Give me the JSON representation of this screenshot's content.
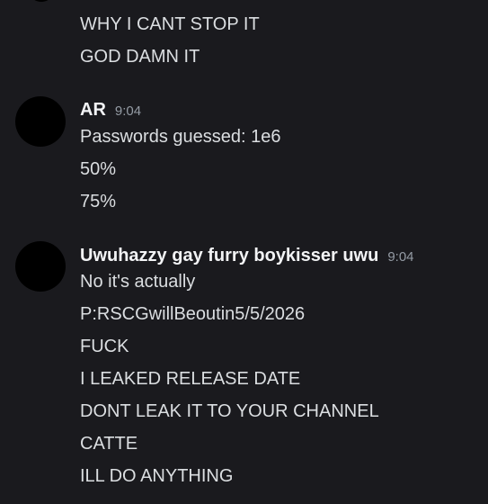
{
  "messages_top": [
    "WHY I CANT STOP IT",
    "GOD DAMN IT"
  ],
  "group_ar": {
    "username": "AR",
    "timestamp": "9:04",
    "lines": [
      "Passwords guessed: 1e6",
      "50%",
      "75%"
    ]
  },
  "group_uwu": {
    "username": "Uwuhazzy gay furry boykisser uwu",
    "timestamp": "9:04",
    "lines": [
      "No it's actually",
      "P:RSCGwillBeoutin5/5/2026",
      "FUCK",
      "I LEAKED RELEASE DATE",
      "DONT LEAK IT TO YOUR CHANNEL",
      "CATTE",
      "ILL DO ANYTHING"
    ]
  },
  "colors": {
    "background": "#1a1a1e",
    "text": "#dbdee1",
    "username": "#f2f3f5",
    "timestamp": "#949ba4"
  }
}
